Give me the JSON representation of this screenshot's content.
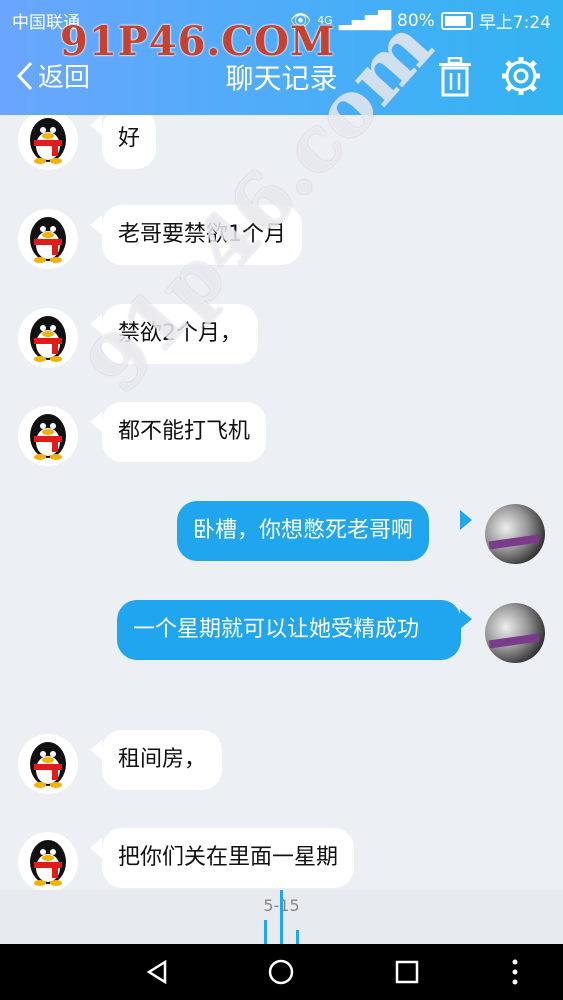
{
  "status_bar": {
    "carrier": "中国联通",
    "network": "4G",
    "battery": "80%",
    "time": "早上7:24"
  },
  "watermark": {
    "top_text": "91P46.COM",
    "diagonal_text": "91p46.com"
  },
  "nav": {
    "back_label": "返回",
    "title": "聊天记录"
  },
  "messages": [
    {
      "side": "left",
      "text": "好"
    },
    {
      "side": "left",
      "text": "老哥要禁欲1个月"
    },
    {
      "side": "left",
      "text": "禁欲2个月，"
    },
    {
      "side": "left",
      "text": "都不能打飞机"
    },
    {
      "side": "right",
      "text": "卧槽，你想憋死老哥啊"
    },
    {
      "side": "right",
      "text": "一个星期就可以让她受精成功"
    },
    {
      "side": "left",
      "text": "租间房，"
    },
    {
      "side": "left",
      "text": "把你们关在里面一星期"
    }
  ],
  "date_bar": {
    "label": "5-15"
  },
  "colors": {
    "header_gradient_start": "#6aa6ff",
    "header_gradient_end": "#32b3f2",
    "sent_bubble": "#1fa6ee",
    "received_bubble": "#ffffff"
  },
  "icons": [
    "back-chevron-icon",
    "trash-icon",
    "settings-gear-icon",
    "penguin-avatar-icon",
    "back-triangle-icon",
    "home-circle-icon",
    "recents-square-icon",
    "more-vertical-icon"
  ]
}
